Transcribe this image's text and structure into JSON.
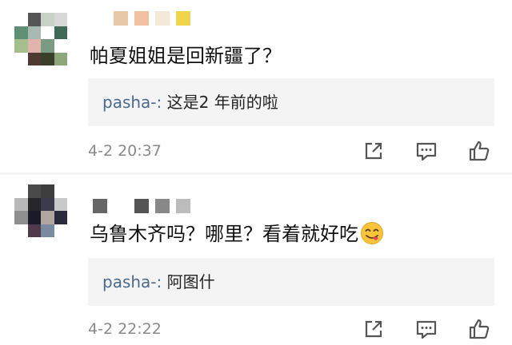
{
  "comments": [
    {
      "text": "帕夏姐姐是回新疆了？",
      "reply_user": "pasha-:",
      "reply_text": "这是2 年前的啦",
      "timestamp": "4-2 20:37",
      "has_emoji": false,
      "avatar_colors": [
        "#ffffff",
        "#555555",
        "#c8d2c6",
        "#d8d8d8",
        "#5f8f74",
        "#a9b9b2",
        "#ffffff",
        "#3f6a58",
        "#a4bf8c",
        "#e2b3ad",
        "#7b9a82",
        "#ffffff",
        "#ffffff",
        "#4e3a32",
        "#3a3f2c",
        "#8da67a"
      ],
      "name_blocks": [
        "#ffffff",
        "#e9c8a8",
        "#f0c0a0",
        "#f4e8d8",
        "#f0d44a"
      ]
    },
    {
      "text": "乌鲁木齐吗？哪里？看着就好吃",
      "reply_user": "pasha-:",
      "reply_text": "阿图什",
      "timestamp": "4-2 22:22",
      "has_emoji": true,
      "avatar_colors": [
        "#ffffff",
        "#4a4a4a",
        "#3e3e3e",
        "#ffffff",
        "#b9b9b9",
        "#26262a",
        "#3a3a4a",
        "#c9c9c9",
        "#8f8f8f",
        "#1a1a28",
        "#b0a8a0",
        "#2a2a3a",
        "#ffffff",
        "#4e3a48",
        "#7a8aa0",
        "#ffffff"
      ],
      "name_blocks": [
        "#666666",
        "#ffffff",
        "#555555",
        "#888888",
        "#bcbcbc"
      ]
    }
  ],
  "actions": {
    "share_icon": "share-icon",
    "comment_icon": "comment-icon",
    "like_icon": "thumbs-up-icon"
  },
  "colors": {
    "reply_user": "#4a6a8c",
    "timestamp": "#8a8a8a",
    "reply_bg": "#f4f4f4"
  }
}
